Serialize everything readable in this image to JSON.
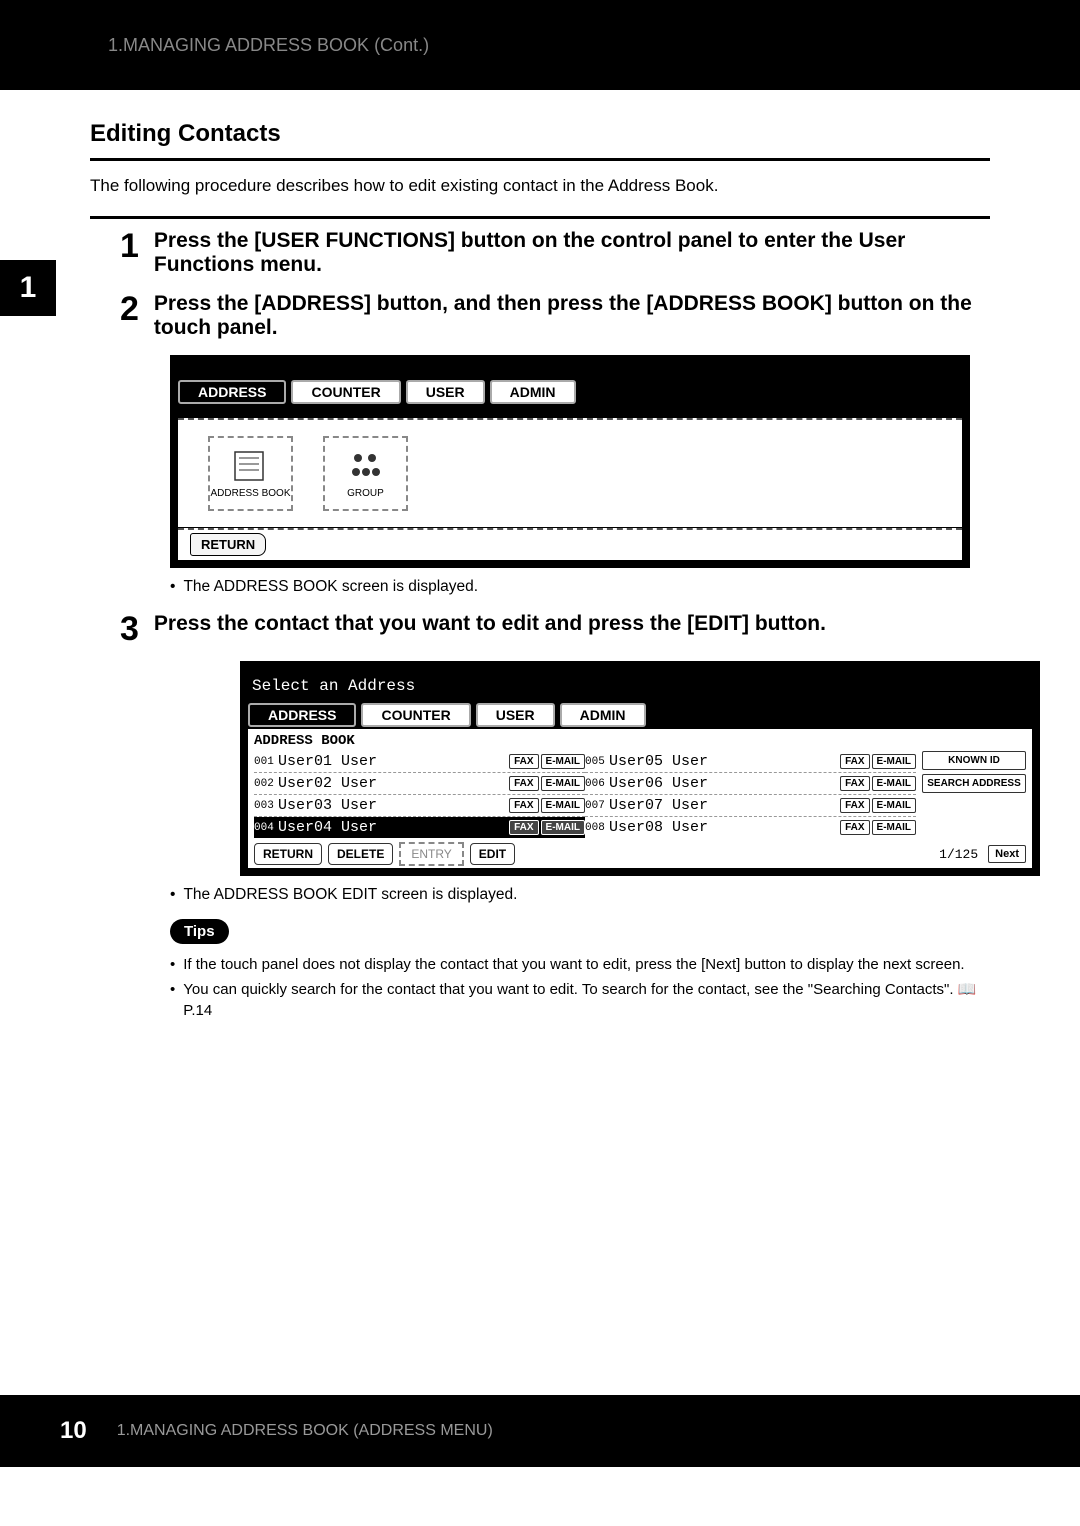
{
  "header": {
    "breadcrumb": "1.MANAGING ADDRESS BOOK (Cont.)"
  },
  "sideTab": "1",
  "section": {
    "title": "Editing Contacts",
    "intro": "The following procedure describes how to edit existing contact in the Address Book."
  },
  "steps": [
    {
      "num": "1",
      "text": "Press the [USER FUNCTIONS] button on the control panel to enter the User Functions menu."
    },
    {
      "num": "2",
      "text": "Press the [ADDRESS] button, and then press the [ADDRESS BOOK] button on the touch panel."
    },
    {
      "num": "3",
      "text": "Press the contact that you want to edit and press the [EDIT] button."
    }
  ],
  "screen1": {
    "tabs": [
      "ADDRESS",
      "COUNTER",
      "USER",
      "ADMIN"
    ],
    "icons": [
      {
        "name": "address-book-icon",
        "label": "ADDRESS BOOK"
      },
      {
        "name": "group-icon",
        "label": "GROUP"
      }
    ],
    "return": "RETURN",
    "note": "The ADDRESS BOOK screen is displayed."
  },
  "screen2": {
    "headerPrompt": "Select an Address",
    "tabs": [
      "ADDRESS",
      "COUNTER",
      "USER",
      "ADMIN"
    ],
    "caption": "ADDRESS BOOK",
    "rowsLeft": [
      {
        "id": "001",
        "name": "User01 User"
      },
      {
        "id": "002",
        "name": "User02 User"
      },
      {
        "id": "003",
        "name": "User03 User"
      },
      {
        "id": "004",
        "name": "User04 User"
      }
    ],
    "rowsRight": [
      {
        "id": "005",
        "name": "User05 User"
      },
      {
        "id": "006",
        "name": "User06 User"
      },
      {
        "id": "007",
        "name": "User07 User"
      },
      {
        "id": "008",
        "name": "User08 User"
      }
    ],
    "faxLabel": "FAX",
    "emailLabel": "E-MAIL",
    "sideButtons": [
      "KNOWN ID",
      "SEARCH ADDRESS"
    ],
    "footer": {
      "return": "RETURN",
      "delete": "DELETE",
      "entry": "ENTRY",
      "edit": "EDIT",
      "page": "1/125",
      "next": "Next"
    },
    "note": "The ADDRESS BOOK EDIT screen is displayed."
  },
  "tips": {
    "label": "Tips",
    "items": [
      "If the touch panel does not display the contact that you want to edit, press the [Next] button to display the next screen.",
      "You can quickly search for the contact that you want to edit.  To search for the contact, see the \"Searching Contacts\".  📖  P.14"
    ]
  },
  "footer": {
    "pageNum": "10",
    "text": "1.MANAGING ADDRESS BOOK (ADDRESS MENU)"
  }
}
